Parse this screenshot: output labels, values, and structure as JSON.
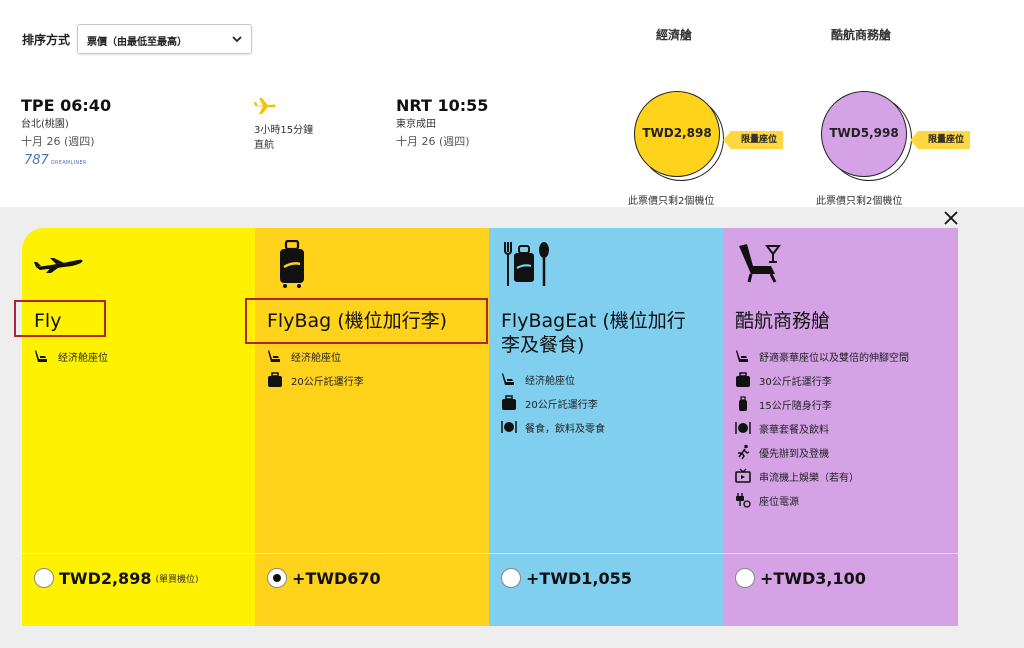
{
  "sort": {
    "label": "排序方式",
    "selected": "票價（由最低至最高）"
  },
  "cabins": {
    "economy": "經濟艙",
    "business": "酷航商務艙"
  },
  "flight": {
    "departure": {
      "code_time": "TPE 06:40",
      "city": "台北(桃園)",
      "date": "十月 26 (週四)"
    },
    "arrival": {
      "code_time": "NRT 10:55",
      "city": "東京成田",
      "date": "十月 26 (週四)"
    },
    "duration": "3小時15分鐘",
    "stops": "直航",
    "aircraft": {
      "number": "787",
      "brand": "DREAMLINER"
    }
  },
  "prices": {
    "economy": {
      "amount": "TWD2,898",
      "tag": "限量座位",
      "seats": "此票價只剩2個機位"
    },
    "business": {
      "amount": "TWD5,998",
      "tag": "限量座位",
      "seats": "此票價只剩2個機位"
    }
  },
  "fares": [
    {
      "title": "Fly",
      "features": [
        "经济舱座位"
      ],
      "price": "TWD2,898",
      "note": "(單買機位)",
      "selected": false
    },
    {
      "title": "FlyBag (機位加行李)",
      "features": [
        "经济舱座位",
        "20公斤託運行李"
      ],
      "price": "+TWD670",
      "note": "",
      "selected": true
    },
    {
      "title_line1": "FlyBagEat (機位加行",
      "title_line2": "李及餐食)",
      "features": [
        "经济舱座位",
        "20公斤託運行李",
        "餐食，飲料及零食"
      ],
      "price": "+TWD1,055",
      "note": "",
      "selected": false
    },
    {
      "title": "酷航商務艙",
      "features": [
        "舒適豪華座位以及雙倍的伸腳空間",
        "30公斤託運行李",
        "15公斤隨身行李",
        "豪華套餐及飲料",
        "優先辦到及登機",
        "串流機上娛樂（若有）",
        "座位電源"
      ],
      "price": "+TWD3,100",
      "note": "",
      "selected": false
    }
  ],
  "colors": {
    "fly": "#fff200",
    "flybag": "#ffd31c",
    "flybageat": "#80cfee",
    "business": "#d5a2e6",
    "highlight": "#b0233a"
  }
}
